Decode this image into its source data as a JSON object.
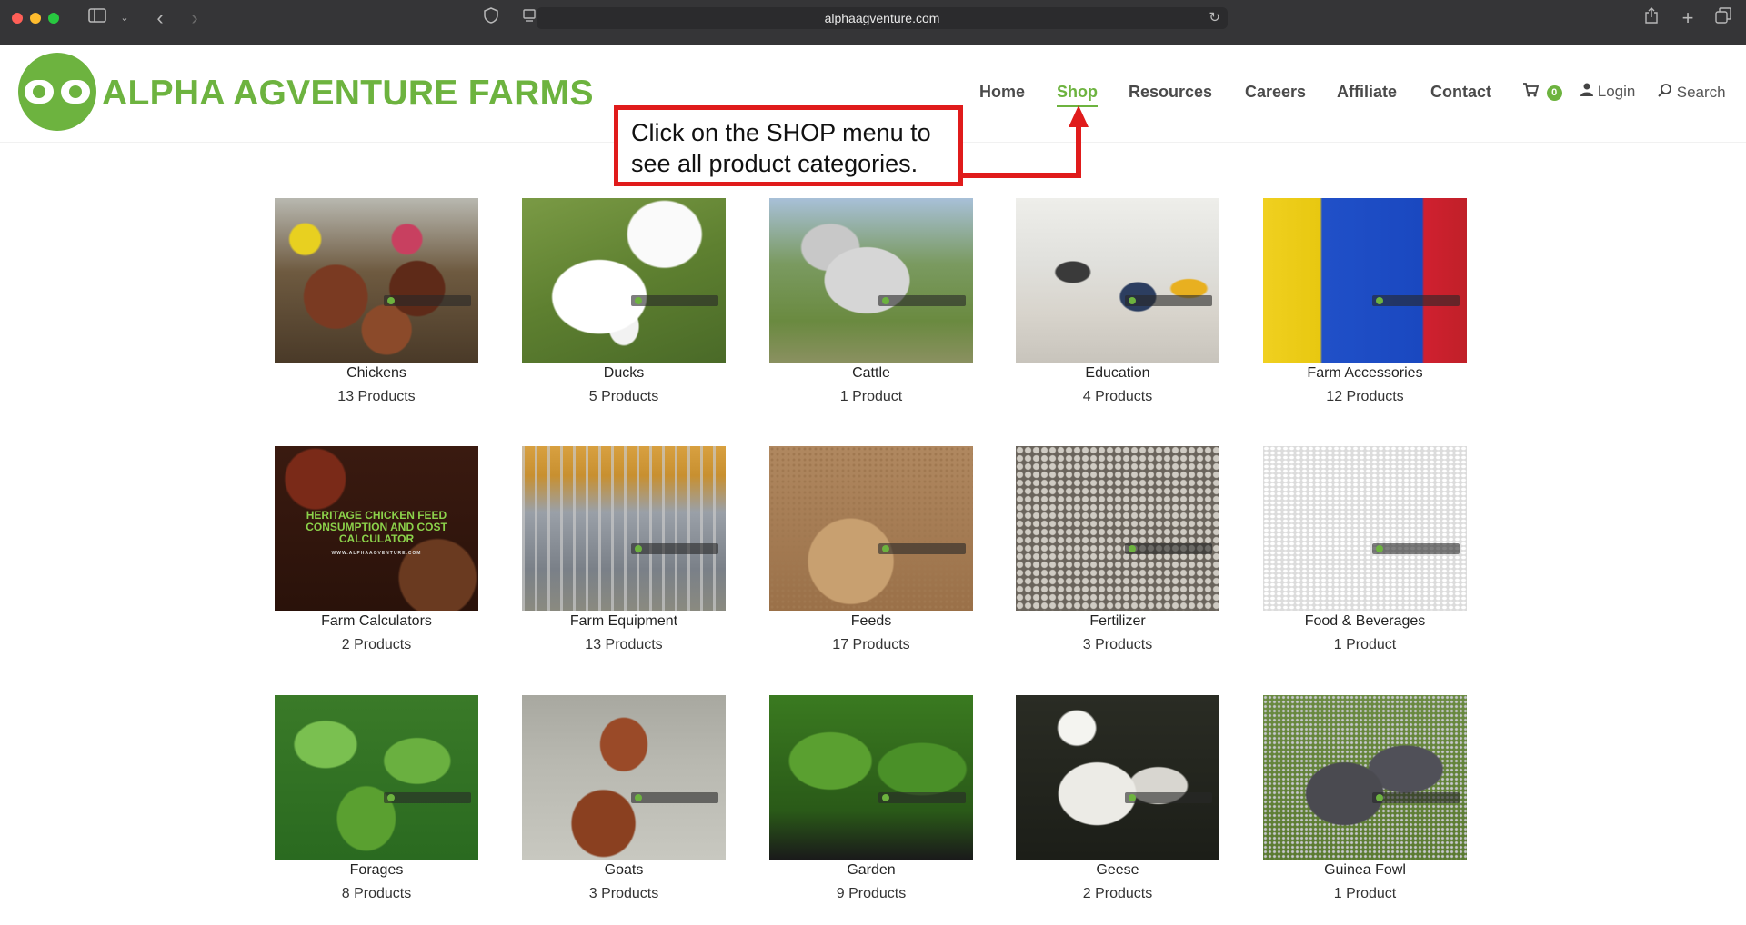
{
  "browser": {
    "url": "alphaagventure.com",
    "icons": [
      "sidebar-icon",
      "chevron-down-icon",
      "back-icon",
      "forward-icon",
      "shield-icon",
      "reader-icon",
      "reload-icon",
      "share-icon",
      "new-tab-icon",
      "tabs-icon"
    ]
  },
  "site": {
    "logo_text": "ALPHA AGVENTURE FARMS",
    "brand_color": "#6db33f"
  },
  "nav": {
    "items": [
      {
        "label": "Home"
      },
      {
        "label": "Shop",
        "active": true
      },
      {
        "label": "Resources"
      },
      {
        "label": "Careers"
      },
      {
        "label": "Affiliate"
      },
      {
        "label": "Contact"
      }
    ],
    "cart_count": "0",
    "login_label": "Login",
    "search_label": "Search"
  },
  "annotation": {
    "line1": "Click on the SHOP menu to",
    "line2": "see all product categories.",
    "color": "#e01b1b"
  },
  "categories": [
    {
      "name": "Chickens",
      "count": "13 Products"
    },
    {
      "name": "Ducks",
      "count": "5 Products"
    },
    {
      "name": "Cattle",
      "count": "1 Product"
    },
    {
      "name": "Education",
      "count": "4 Products"
    },
    {
      "name": "Farm Accessories",
      "count": "12 Products"
    },
    {
      "name": "Farm Calculators",
      "count": "2 Products",
      "image_text": "HERITAGE CHICKEN FEED CONSUMPTION AND COST CALCULATOR",
      "image_subtext": "WWW.ALPHAAGVENTURE.COM"
    },
    {
      "name": "Farm Equipment",
      "count": "13 Products"
    },
    {
      "name": "Feeds",
      "count": "17 Products"
    },
    {
      "name": "Fertilizer",
      "count": "3 Products"
    },
    {
      "name": "Food & Beverages",
      "count": "1 Product"
    },
    {
      "name": "Forages",
      "count": "8 Products"
    },
    {
      "name": "Goats",
      "count": "3 Products"
    },
    {
      "name": "Garden",
      "count": "9 Products"
    },
    {
      "name": "Geese",
      "count": "2 Products"
    },
    {
      "name": "Guinea Fowl",
      "count": "1 Product"
    }
  ]
}
